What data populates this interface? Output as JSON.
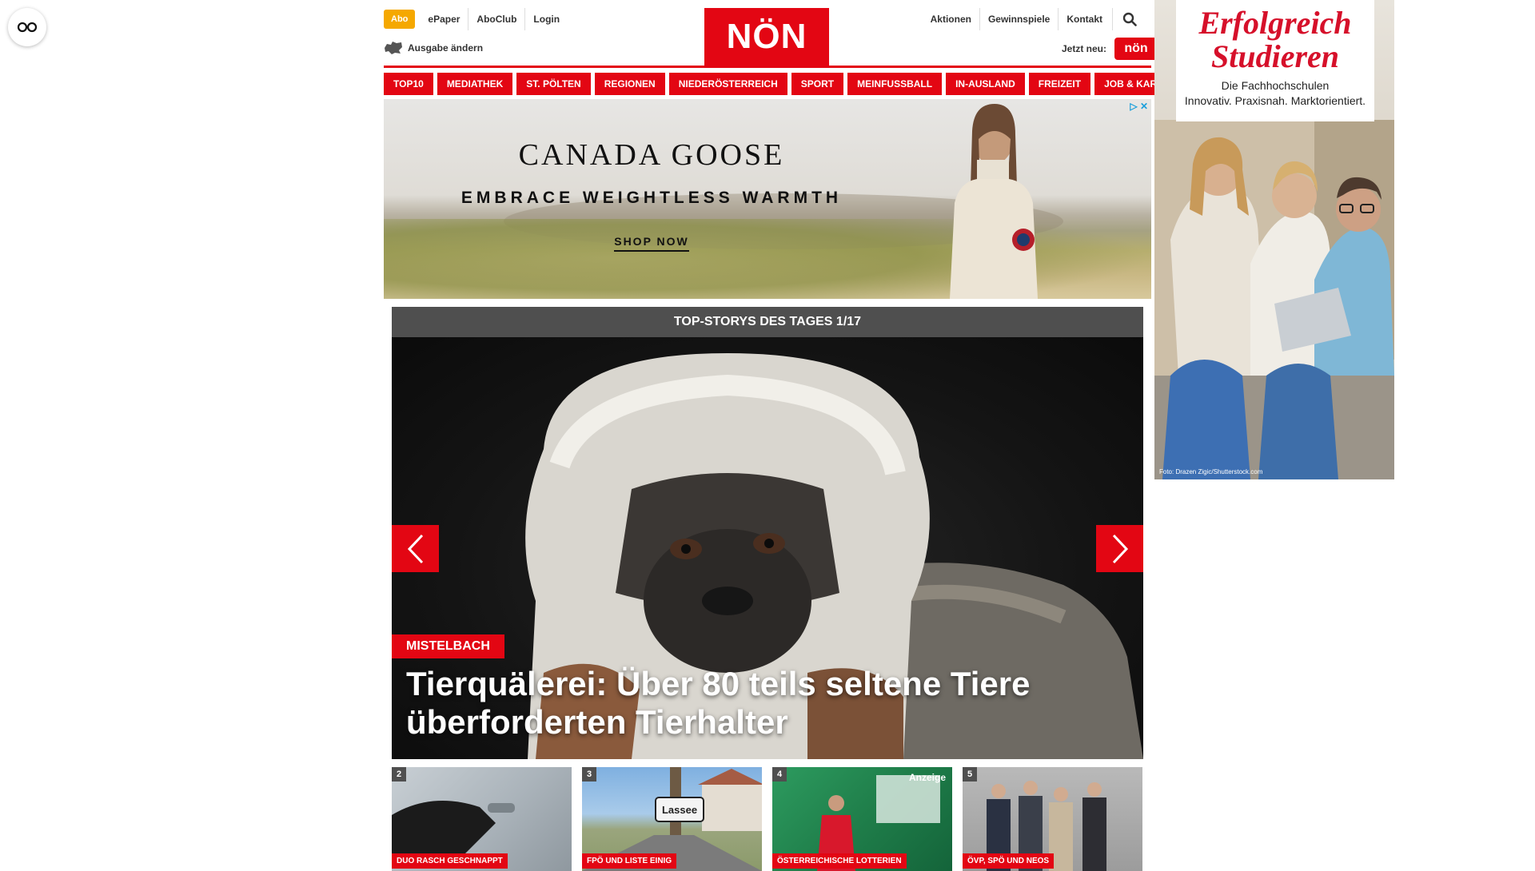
{
  "header": {
    "abo_label": "Abo",
    "top_links": [
      "ePaper",
      "AboClub",
      "Login"
    ],
    "right_links": [
      "Aktionen",
      "Gewinnspiele",
      "Kontakt"
    ],
    "logo_text": "NÖN",
    "edition_label": "Ausgabe ändern",
    "new_label": "Jetzt neu:",
    "app_label": "nön"
  },
  "nav": {
    "items": [
      "TOP10",
      "MEDIATHEK",
      "ST. PÖLTEN",
      "REGIONEN",
      "NIEDERÖSTERREICH",
      "SPORT",
      "MEINFUSSBALL",
      "IN-AUSLAND",
      "FREIZEIT",
      "JOB & KARRIERE"
    ]
  },
  "banner_ad": {
    "brand": "CANADA GOOSE",
    "tagline": "EMBRACE WEIGHTLESS WARMTH",
    "cta": "SHOP NOW"
  },
  "slider": {
    "title": "TOP-STORYS DES TAGES 1/17",
    "tag": "MISTELBACH",
    "headline_line1": "Tierquälerei: Über 80 teils seltene Tiere",
    "headline_line2": "überforderten Tierhalter"
  },
  "thumbnails": [
    {
      "num": "2",
      "tag": "DUO RASCH GESCHNAPPT"
    },
    {
      "num": "3",
      "tag": "FPÖ UND LISTE EINIG",
      "sign": "Lassee"
    },
    {
      "num": "4",
      "tag": "ÖSTERREICHISCHE LOTTERIEN",
      "badge": "Anzeige"
    },
    {
      "num": "5",
      "tag": "ÖVP, SPÖ UND NEOS"
    }
  ],
  "sky_ad": {
    "headline_line1": "Erfolgreich",
    "headline_line2": "Studieren",
    "sub_line1": "Die Fachhochschulen",
    "sub_line2": "Innovativ. Praxisnah. Marktorientiert.",
    "credit": "Foto: Drazen Zigic/Shutterstock.com"
  },
  "colors": {
    "brand_red": "#e30613",
    "abo_orange": "#f5a800",
    "slider_bar": "#4f4f4f"
  },
  "icons": [
    "accessibility-icon",
    "search-icon",
    "map-icon",
    "arrow-left-icon",
    "arrow-right-icon",
    "adchoices-icon"
  ]
}
